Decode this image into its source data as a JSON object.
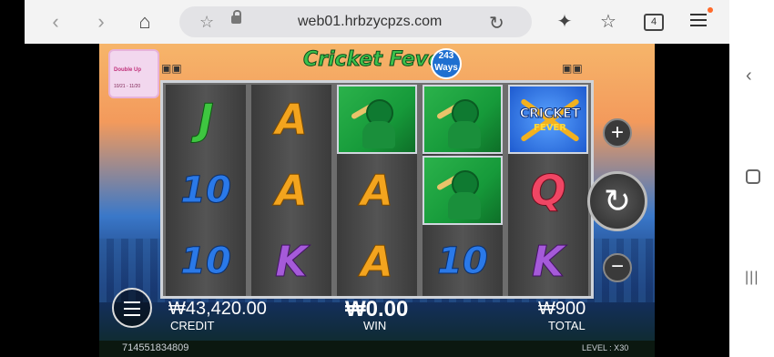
{
  "browser": {
    "url": "web01.hrbzycpzs.com",
    "tabs_count": "4",
    "accent_dot_color": "#ff6a2a"
  },
  "game": {
    "title": "Cricket Fever",
    "ways_badge": "243 Ways",
    "promo_banner": {
      "line1": "Double Up",
      "line2": "10/21 - 11/20"
    },
    "reels": [
      [
        "J",
        "10",
        "10"
      ],
      [
        "A",
        "A",
        "K"
      ],
      [
        "batsman",
        "A",
        "A"
      ],
      [
        "batsman",
        "batsman",
        "10"
      ],
      [
        "scatter",
        "Q",
        "K"
      ]
    ],
    "scatter_text": {
      "line1": "CRICKET",
      "line2": "FEVER"
    },
    "buttons": {
      "plus": "+",
      "minus": "−",
      "spin": "↻"
    },
    "hud": {
      "credit_value": "₩43,420.00",
      "credit_label": "CREDIT",
      "win_value": "₩0.00",
      "win_label": "WIN",
      "total_value": "₩900",
      "total_label": "TOTAL"
    },
    "footer": {
      "session_id": "714551834809",
      "level": "LEVEL : X30"
    }
  }
}
